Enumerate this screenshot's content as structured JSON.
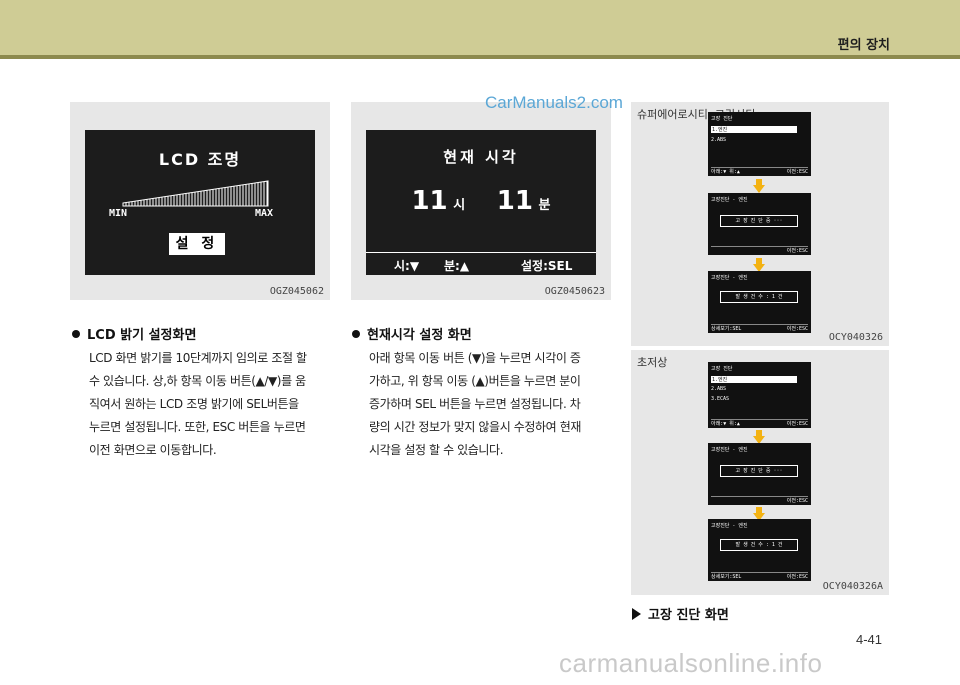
{
  "header": {
    "title": "편의 장치"
  },
  "watermark": {
    "top": "CarManuals2.com",
    "bottom": "carmanualsonline.info"
  },
  "figure1": {
    "code": "OGZ045062",
    "lcd_title": "LCD 조명",
    "min_label": "MIN",
    "max_label": "MAX",
    "button_label": "설 정",
    "brightness_level": 1.0
  },
  "figure2": {
    "code": "OGZ0450623",
    "lcd_title": "현재 시각",
    "hour_value": "11",
    "hour_unit": "시",
    "minute_value": "11",
    "minute_unit": "분",
    "foot_hour": "시:▼",
    "foot_minute": "분:▲",
    "foot_set": "설정:SEL"
  },
  "figure3": {
    "label": "슈퍼에어로시티, 그린시티",
    "code": "OCY040326",
    "screen1": {
      "title": "고장 진단",
      "item1": "1.엔진",
      "item2": "2.ABS",
      "foot_left": "아래:▼  위:▲",
      "foot_right": "이전:ESC"
    },
    "screen2": {
      "title": "고장진단 - 엔진",
      "box": "고 장 진 단 중 ···",
      "foot_right": "이전:ESC"
    },
    "screen3": {
      "title": "고장진단 - 엔진",
      "box": "발 생 건 수 :  1  건",
      "foot_left": "상세보기:SEL",
      "foot_right": "이전:ESC"
    }
  },
  "figure4": {
    "label": "초저상",
    "code": "OCY040326A",
    "screen1": {
      "title": "고장 진단",
      "item1": "1.엔진",
      "item2": "2.ABS",
      "item3": "3.ECAS",
      "foot_left": "아래:▼  위:▲",
      "foot_right": "이전:ESC"
    },
    "screen2": {
      "title": "고장진단 - 엔진",
      "box": "고 장 진 단 중 ···",
      "foot_right": "이전:ESC"
    },
    "screen3": {
      "title": "고장진단 - 엔진",
      "box": "발 생 건 수 :  1  건",
      "foot_left": "상세보기:SEL",
      "foot_right": "이전:ESC"
    }
  },
  "section1": {
    "title": "LCD 밝기 설정화면",
    "lines": [
      "LCD 화면 밝기를 10단계까지 임의로 조절 할",
      "수 있습니다. 상,하 항목 이동 버튼(▲/▼)를 움",
      "직여서 원하는 LCD 조명 밝기에 SEL버튼을",
      "누르면 설정됩니다. 또한, ESC 버튼을 누르면",
      "이전 화면으로 이동합니다."
    ]
  },
  "section2": {
    "title": "현재시각 설정 화면",
    "lines": [
      "아래 항목 이동 버튼 (▼)을 누르면 시각이 증",
      "가하고, 위 항목 이동 (▲)버튼을 누르면 분이",
      "증가하며 SEL 버튼을 누르면 설정됩니다. 차",
      "량의 시간 정보가 맞지 않을시 수정하여 현재",
      "시각을 설정 할 수 있습니다."
    ]
  },
  "caption": "고장 진단 화면",
  "page_number": "4-41"
}
